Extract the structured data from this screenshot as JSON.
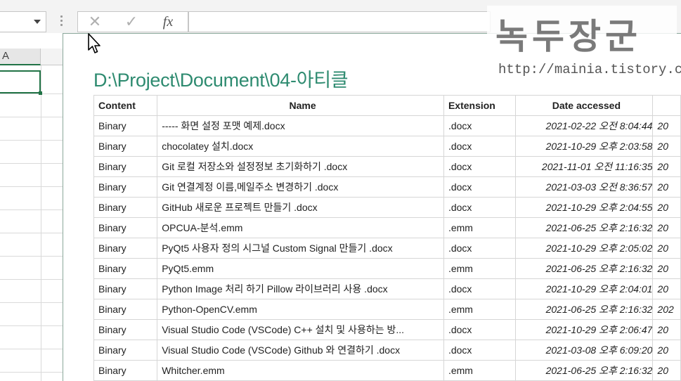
{
  "excel": {
    "cancel_glyph": "✕",
    "enter_glyph": "✓",
    "fx_label": "fx",
    "column_a": "A"
  },
  "popup": {
    "path_title": "D:\\Project\\Document\\04-아티클",
    "headers": {
      "content": "Content",
      "name": "Name",
      "extension": "Extension",
      "date_accessed": "Date accessed"
    },
    "rows": [
      {
        "content": "Binary",
        "name": "----- 화면 설정 포맷 예제.docx",
        "extension": ".docx",
        "date_accessed": "2021-02-22 오전 8:04:44",
        "next": "20"
      },
      {
        "content": "Binary",
        "name": "chocolatey 설치.docx",
        "extension": ".docx",
        "date_accessed": "2021-10-29 오후 2:03:58",
        "next": "20"
      },
      {
        "content": "Binary",
        "name": "Git 로컬 저장소와 설정정보 초기화하기 .docx",
        "extension": ".docx",
        "date_accessed": "2021-11-01 오전 11:16:35",
        "next": "20"
      },
      {
        "content": "Binary",
        "name": "Git 연결계정 이름,메일주소 변경하기 .docx",
        "extension": ".docx",
        "date_accessed": "2021-03-03 오전 8:36:57",
        "next": "20"
      },
      {
        "content": "Binary",
        "name": "GitHub 새로운 프로젝트 만들기 .docx",
        "extension": ".docx",
        "date_accessed": "2021-10-29 오후 2:04:55",
        "next": "20"
      },
      {
        "content": "Binary",
        "name": "OPCUA-분석.emm",
        "extension": ".emm",
        "date_accessed": "2021-06-25 오후 2:16:32",
        "next": "20"
      },
      {
        "content": "Binary",
        "name": "PyQt5 사용자 정의 시그널 Custom Signal 만들기 .docx",
        "extension": ".docx",
        "date_accessed": "2021-10-29 오후 2:05:02",
        "next": "20"
      },
      {
        "content": "Binary",
        "name": "PyQt5.emm",
        "extension": ".emm",
        "date_accessed": "2021-06-25 오후 2:16:32",
        "next": "20"
      },
      {
        "content": "Binary",
        "name": "Python Image 처리 하기 Pillow 라이브러리 사용 .docx",
        "extension": ".docx",
        "date_accessed": "2021-10-29 오후 2:04:01",
        "next": "20"
      },
      {
        "content": "Binary",
        "name": "Python-OpenCV.emm",
        "extension": ".emm",
        "date_accessed": "2021-06-25 오후 2:16:32",
        "next": "202"
      },
      {
        "content": "Binary",
        "name": "Visual Studio Code (VSCode) C++ 설치 및 사용하는 방...",
        "extension": ".docx",
        "date_accessed": "2021-10-29 오후 2:06:47",
        "next": "20"
      },
      {
        "content": "Binary",
        "name": "Visual Studio Code (VSCode) Github 와 연결하기 .docx",
        "extension": ".docx",
        "date_accessed": "2021-03-08 오후 6:09:20",
        "next": "20"
      },
      {
        "content": "Binary",
        "name": "Whitcher.emm",
        "extension": ".emm",
        "date_accessed": "2021-06-25 오후 2:16:32",
        "next": "20"
      }
    ]
  },
  "watermark": {
    "title": "녹두장군",
    "url": "http://mainia.tistory.com"
  },
  "colors": {
    "accent": "#2e8b70",
    "excel_green": "#217346"
  }
}
